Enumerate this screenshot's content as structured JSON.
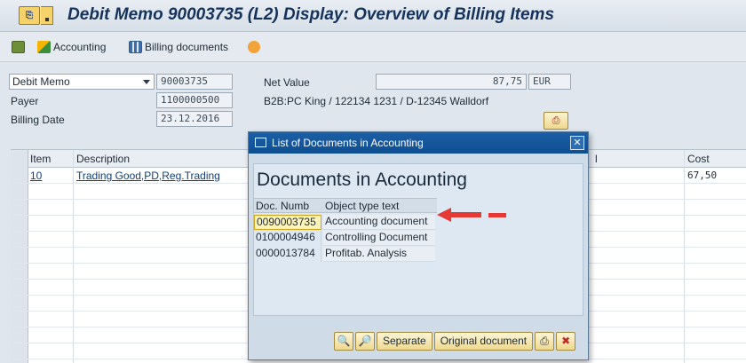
{
  "window": {
    "menu_icon": "sap-menu-icon",
    "title": "Debit Memo 90003735   (L2) Display: Overview of Billing Items"
  },
  "toolbar": {
    "accounting_label": "Accounting",
    "billing_docs_label": "Billing documents"
  },
  "header": {
    "doc_type": "Debit Memo",
    "doc_number": "90003735",
    "net_value_label": "Net Value",
    "net_value": "87,75",
    "currency": "EUR",
    "payer_label": "Payer",
    "payer": "1100000500",
    "payer_desc": "B2B:PC King / 122134 1231 / D-12345 Walldorf",
    "billing_date_label": "Billing Date",
    "billing_date": "23.12.2016"
  },
  "table": {
    "headers": {
      "item": "Item",
      "description": "Description",
      "mid": "l",
      "cost": "Cost"
    },
    "rows": [
      {
        "item": "10",
        "description": "Trading Good,PD,Reg.Trading",
        "cost": "67,50"
      }
    ]
  },
  "dialog": {
    "title": "List of Documents in Accounting",
    "heading": "Documents in Accounting",
    "col_doc": "Doc. Numb",
    "col_type": "Object type text",
    "rows": [
      {
        "doc": "0090003735",
        "type": "Accounting document"
      },
      {
        "doc": "0100004946",
        "type": "Controlling Document"
      },
      {
        "doc": "0000013784",
        "type": "Profitab. Analysis"
      }
    ],
    "separate_label": "Separate",
    "original_label": "Original document",
    "accent": "#1c5fa6",
    "annotation_color": "#e53935"
  }
}
